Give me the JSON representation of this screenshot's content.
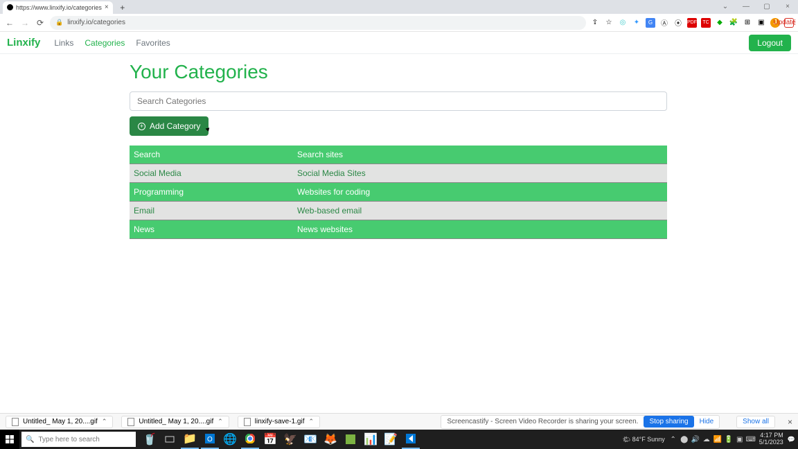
{
  "browser": {
    "tab_title": "https://www.linxify.io/categories",
    "url": "linxify.io/categories",
    "update_label": "Update",
    "avatar_initial": "J"
  },
  "nav": {
    "brand": "Linxify",
    "links": [
      "Links",
      "Categories",
      "Favorites"
    ],
    "active_index": 1,
    "logout": "Logout"
  },
  "page": {
    "title": "Your Categories",
    "search_placeholder": "Search Categories",
    "add_button": "Add Category"
  },
  "categories": [
    {
      "name": "Search",
      "desc": "Search sites"
    },
    {
      "name": "Social Media",
      "desc": "Social Media Sites"
    },
    {
      "name": "Programming",
      "desc": "Websites for coding"
    },
    {
      "name": "Email",
      "desc": "Web-based email"
    },
    {
      "name": "News",
      "desc": "News websites"
    }
  ],
  "downloads": {
    "items": [
      "Untitled_ May 1, 20....gif",
      "Untitled_ May 1, 20....gif",
      "linxify-save-1.gif"
    ],
    "share_msg": "Screencastify - Screen Video Recorder is sharing your screen.",
    "stop": "Stop sharing",
    "hide": "Hide",
    "show_all": "Show all"
  },
  "taskbar": {
    "search_placeholder": "Type here to search",
    "weather": "84°F  Sunny",
    "time": "4:17 PM",
    "date": "5/1/2023"
  }
}
